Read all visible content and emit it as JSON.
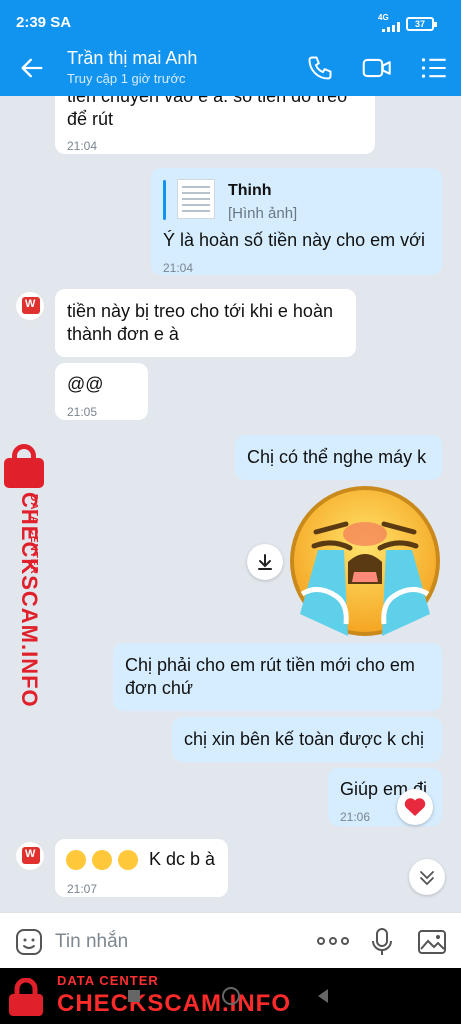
{
  "status_bar": {
    "time": "2:39 SA",
    "network": "4G",
    "battery": "37"
  },
  "header": {
    "contact_name": "Trần thị mai Anh",
    "last_seen": "Truy cập 1 giờ trước"
  },
  "messages": {
    "m0": {
      "lines": [
        "tiền chuyển vào e à. số tiền đó treo",
        "để rút"
      ],
      "time": "21:04"
    },
    "m1": {
      "reply_sender": "Thinh",
      "reply_preview": "[Hình ảnh]",
      "text": "Ý là hoàn số tiền này cho em với",
      "time": "21:04"
    },
    "m2": {
      "lines": [
        "tiền này bị treo cho tới khi e hoàn",
        "thành đơn e à"
      ]
    },
    "m3": {
      "text": "@@",
      "time": "21:05"
    },
    "m4": {
      "text": "Chị có thể nghe máy k"
    },
    "m5": {
      "lines": [
        "Chị phải cho em rút tiền mới cho em",
        "đơn chứ"
      ]
    },
    "m6": {
      "text": "chị xin bên kế toàn được k chị"
    },
    "m7": {
      "text": "Giúp em đi",
      "time": "21:06",
      "reaction": "heart"
    },
    "m8": {
      "text": "K dc b à",
      "time": "21:07"
    }
  },
  "composer": {
    "placeholder": "Tin nhắn"
  },
  "watermark": {
    "label": "DATA CENTER",
    "site": "CHECKSCAM.INFO",
    "color": "#e0202a"
  },
  "colors": {
    "accent": "#1193f0",
    "outgoing_bubble": "#d5edfe",
    "background": "#e2e7ee"
  }
}
